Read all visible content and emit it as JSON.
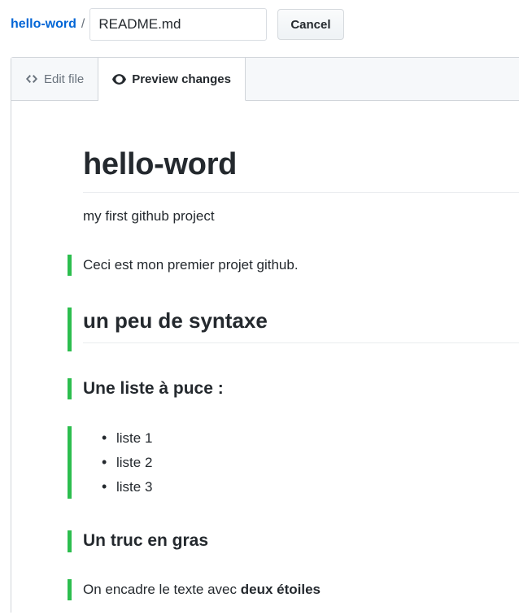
{
  "header": {
    "breadcrumb": {
      "repo": "hello-word",
      "separator": "/"
    },
    "filename_input": {
      "value": "README.md",
      "placeholder": "Name your file..."
    },
    "cancel_label": "Cancel"
  },
  "tabs": [
    {
      "label": "Edit file",
      "icon": "code-icon",
      "active": false
    },
    {
      "label": "Preview changes",
      "icon": "eye-icon",
      "active": true
    }
  ],
  "preview": {
    "h1": "hello-word",
    "intro_paragraph": "my first github project",
    "added_paragraph": "Ceci est mon premier projet github.",
    "h2": "un peu de syntaxe",
    "h3_list": "Une liste à puce :",
    "list_items": [
      "liste 1",
      "liste 2",
      "liste 3"
    ],
    "h3_bold": "Un truc en gras",
    "bold_paragraph_prefix": "On encadre le texte avec ",
    "bold_paragraph_strong": "deux étoiles"
  },
  "colors": {
    "link": "#0366d6",
    "added_bar": "#2cbe4e",
    "text": "#24292e",
    "muted": "#6a737d",
    "border": "#d1d5da",
    "tabbar_bg": "#f6f8fa"
  }
}
